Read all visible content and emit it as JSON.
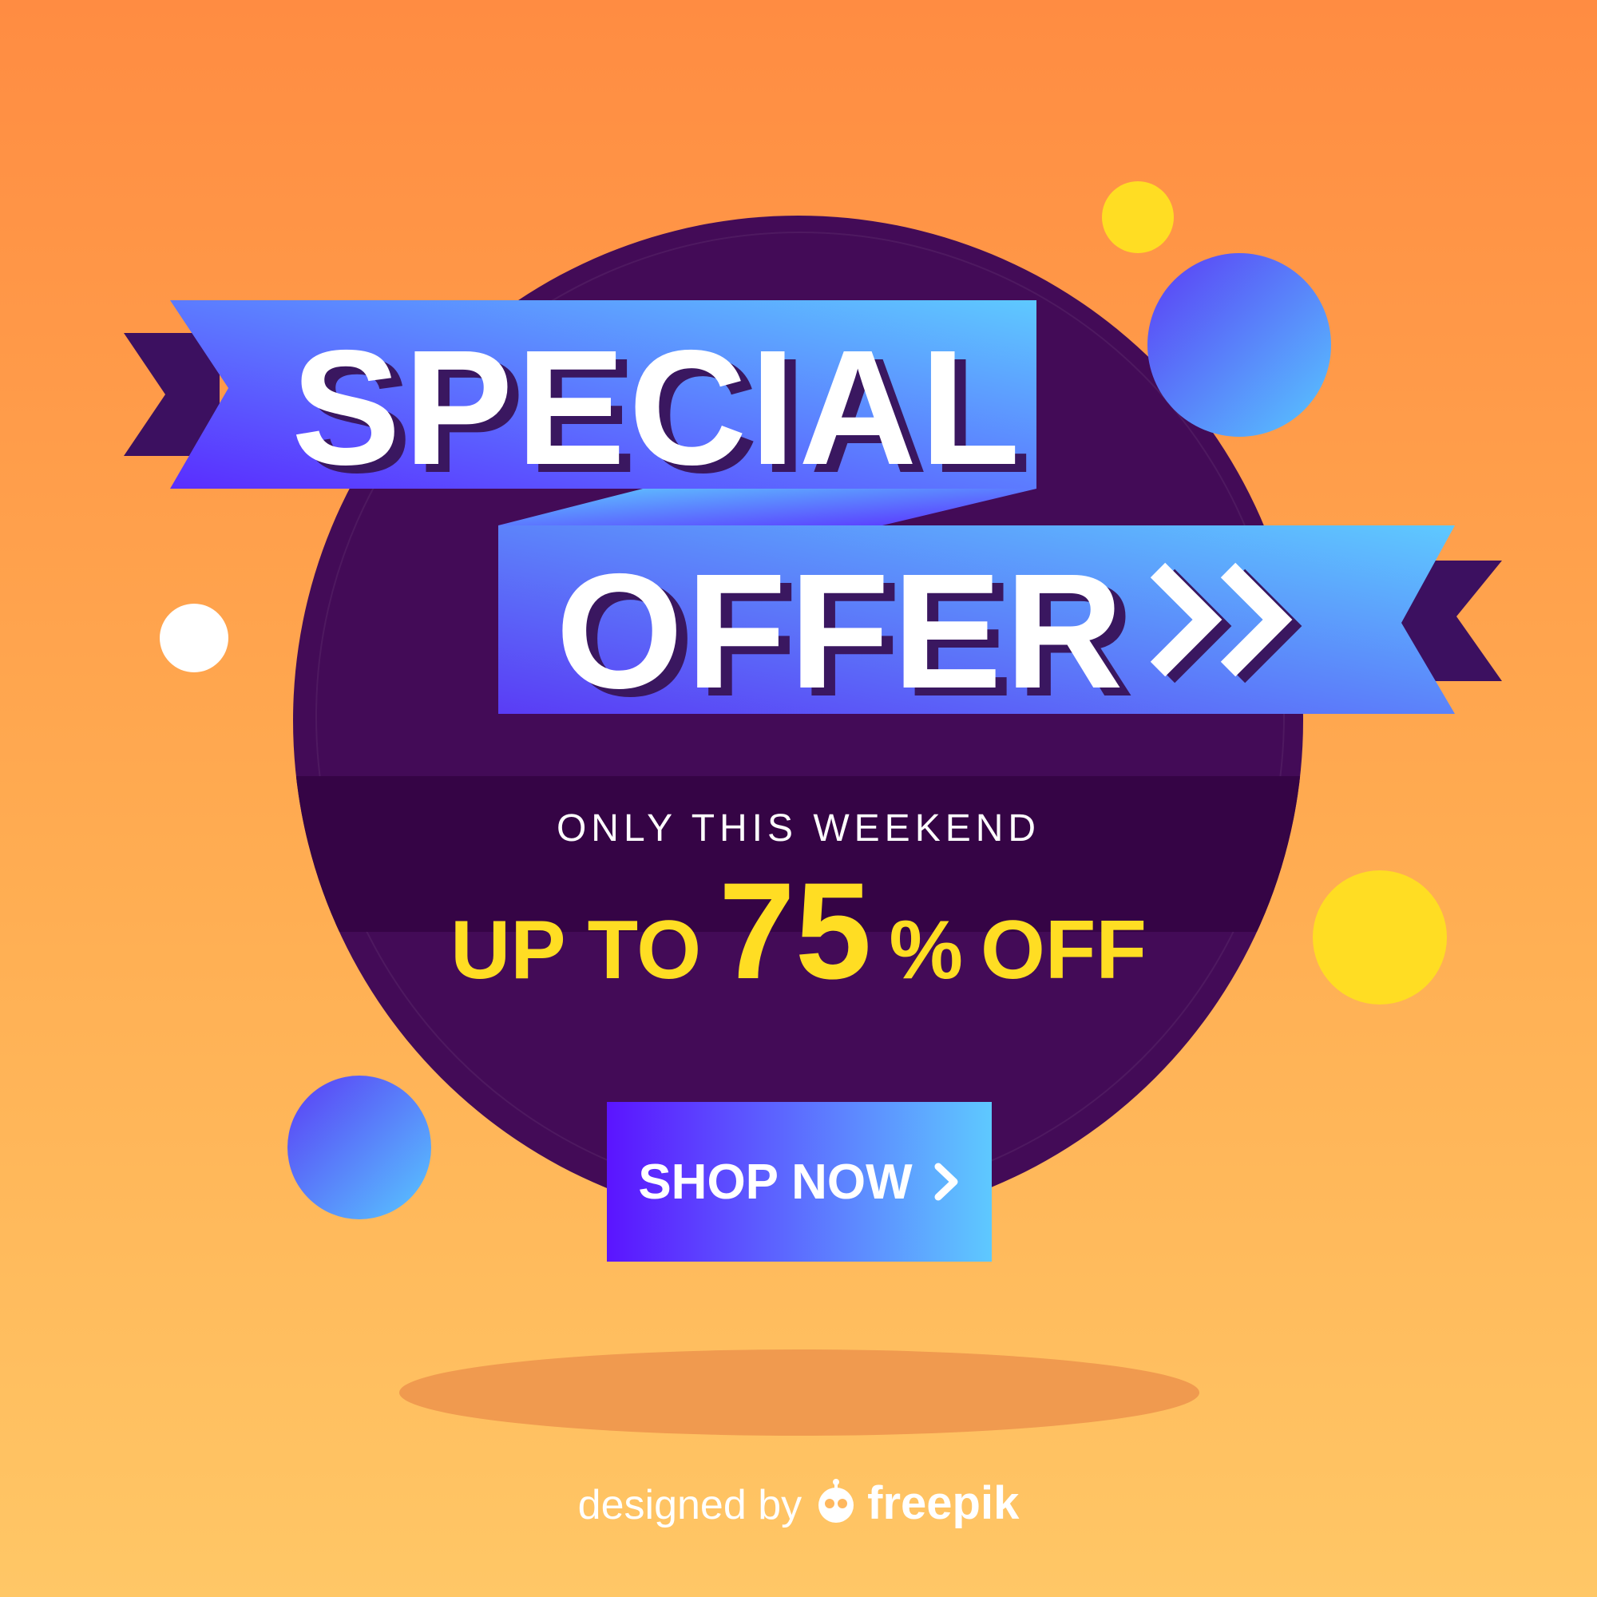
{
  "banner": {
    "title_line1": "SPECIAL",
    "title_line2": "OFFER",
    "subtitle": "ONLY THIS WEEKEND",
    "discount_prefix": "UP TO",
    "discount_value": "75",
    "discount_percent": "%",
    "discount_suffix": "OFF"
  },
  "cta": {
    "label": "SHOP NOW"
  },
  "credit": {
    "prefix": "designed by",
    "brand": "freepik"
  },
  "colors": {
    "background_top": "#ff8c42",
    "background_bottom": "#ffc766",
    "circle": "#430b57",
    "accent_yellow": "#ffdd23",
    "ribbon_start": "#5a3cf5",
    "ribbon_end": "#5ec9ff",
    "ribbon_tail": "#3c1060"
  },
  "icons": [
    "double-chevron-right-icon",
    "chevron-right-icon",
    "freepik-logo-icon"
  ]
}
